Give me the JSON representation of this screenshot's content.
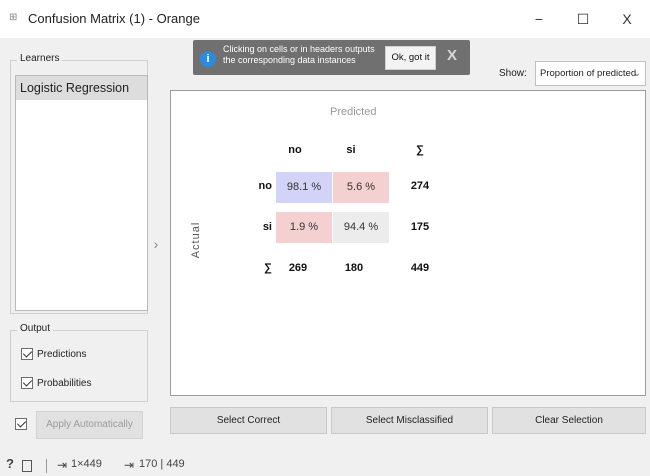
{
  "window": {
    "title": "Confusion Matrix (1) - Orange",
    "minimize": "−",
    "maximize": "☐",
    "close": "X"
  },
  "sidebar": {
    "learners_title": "Learners",
    "learners": [
      "Logistic Regression"
    ],
    "output_title": "Output",
    "predictions_label": "Predictions",
    "probabilities_label": "Probabilities",
    "predictions_checked": true,
    "probabilities_checked": true,
    "apply_label": "Apply Automatically",
    "apply_checked": true,
    "collapse_glyph": "›"
  },
  "notification": {
    "icon": "i",
    "text": "Clicking on cells or in headers outputs the corresponding data instances",
    "ok_label": "Ok, got it",
    "close_label": "X"
  },
  "show": {
    "label": "Show:",
    "value": "Proportion of predicted"
  },
  "matrix": {
    "predicted_label": "Predicted",
    "actual_label": "Actual",
    "col_headers": [
      "no",
      "si",
      "∑"
    ],
    "row_headers": [
      "no",
      "si",
      "∑"
    ],
    "cells": [
      [
        "98.1 %",
        "5.6 %"
      ],
      [
        "1.9 %",
        "94.4 %"
      ]
    ],
    "row_totals": [
      "274",
      "175"
    ],
    "col_totals": [
      "269",
      "180",
      "449"
    ],
    "colors": {
      "correct": "#d3d3f7",
      "incorrect": "#f4d0d0",
      "neutral": "#ececec"
    }
  },
  "actions": {
    "select_correct": "Select Correct",
    "select_misclassified": "Select Misclassified",
    "clear_selection": "Clear Selection"
  },
  "status": {
    "help": "?",
    "input_summary": "1×449",
    "output_summary": "170 | 449"
  }
}
